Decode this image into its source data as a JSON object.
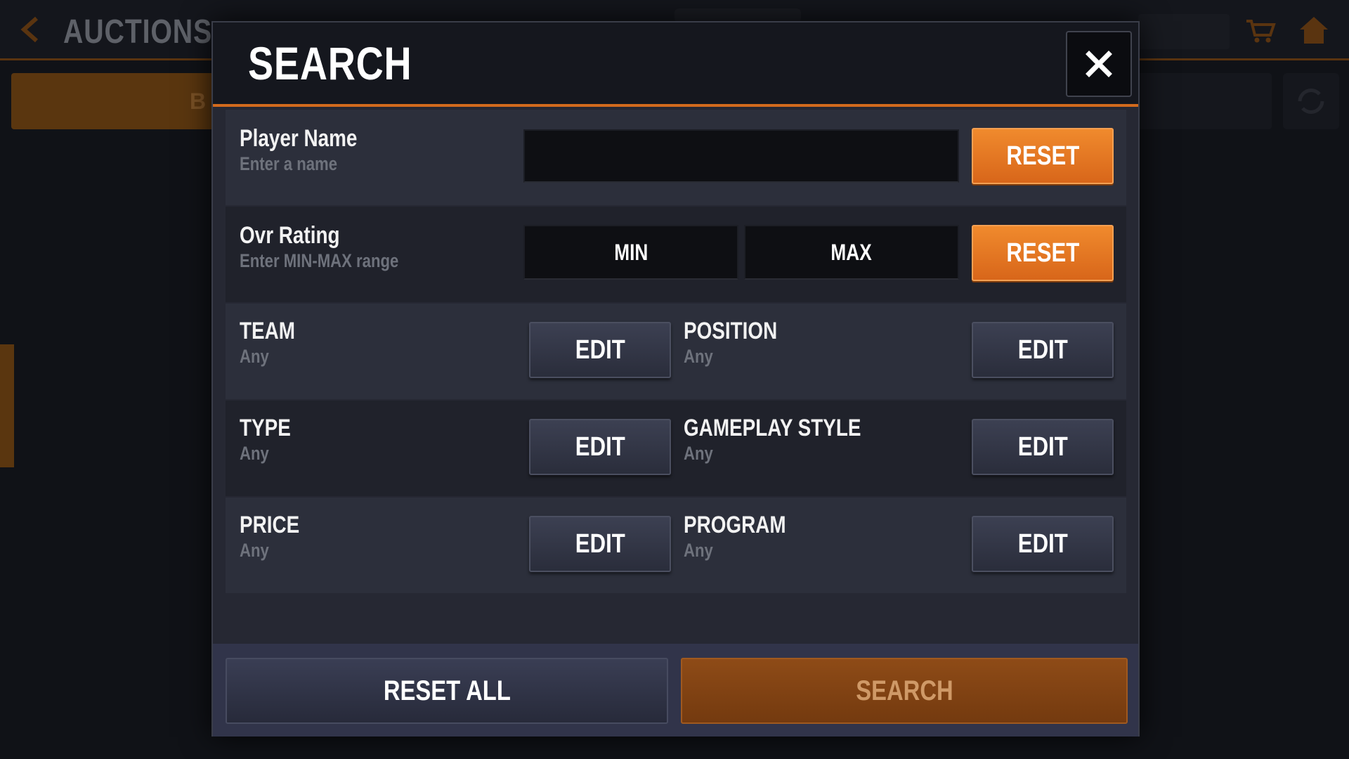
{
  "background": {
    "title": "AUCTIONS",
    "orange_tab_partial_label": "B",
    "icons": [
      "chevron-left-icon",
      "cart-icon",
      "home-icon",
      "refresh-icon"
    ]
  },
  "modal": {
    "title": "SEARCH",
    "close_label": "×",
    "player_name": {
      "label": "Player Name",
      "hint": "Enter a name",
      "value": "",
      "reset_label": "RESET"
    },
    "ovr_rating": {
      "label": "Ovr Rating",
      "hint": "Enter MIN-MAX range",
      "min_label": "MIN",
      "max_label": "MAX",
      "reset_label": "RESET"
    },
    "filters": [
      {
        "label": "TEAM",
        "value": "Any",
        "button": "EDIT"
      },
      {
        "label": "POSITION",
        "value": "Any",
        "button": "EDIT"
      },
      {
        "label": "TYPE",
        "value": "Any",
        "button": "EDIT"
      },
      {
        "label": "GAMEPLAY STYLE",
        "value": "Any",
        "button": "EDIT"
      },
      {
        "label": "PRICE",
        "value": "Any",
        "button": "EDIT"
      },
      {
        "label": "PROGRAM",
        "value": "Any",
        "button": "EDIT"
      }
    ],
    "footer": {
      "reset_all_label": "RESET ALL",
      "search_label": "SEARCH"
    }
  },
  "colors": {
    "accent_orange": "#e8781f",
    "modal_bg": "#262833",
    "header_bg": "#15171e",
    "edit_button": "#333646"
  }
}
